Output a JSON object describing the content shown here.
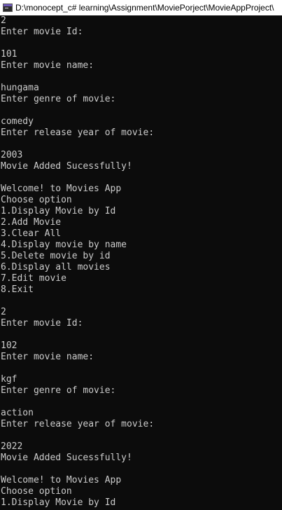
{
  "window": {
    "title": "D:\\monocept_c# learning\\Assignment\\MoviePorject\\MovieAppProject\\",
    "icon": "console-app-icon"
  },
  "console": {
    "lines": [
      "2",
      "Enter movie Id:",
      "",
      "101",
      "Enter movie name:",
      "",
      "hungama",
      "Enter genre of movie:",
      "",
      "comedy",
      "Enter release year of movie:",
      "",
      "2003",
      "Movie Added Sucessfully!",
      "",
      "Welcome! to Movies App",
      "Choose option",
      "1.Display Movie by Id",
      "2.Add Movie",
      "3.Clear All",
      "4.Display movie by name",
      "5.Delete movie by id",
      "6.Display all movies",
      "7.Edit movie",
      "8.Exit",
      "",
      "2",
      "Enter movie Id:",
      "",
      "102",
      "Enter movie name:",
      "",
      "kgf",
      "Enter genre of movie:",
      "",
      "action",
      "Enter release year of movie:",
      "",
      "2022",
      "Movie Added Sucessfully!",
      "",
      "Welcome! to Movies App",
      "Choose option",
      "1.Display Movie by Id"
    ]
  },
  "colors": {
    "background": "#0c0c0c",
    "text": "#cccccc",
    "titlebar": "#ffffff"
  }
}
